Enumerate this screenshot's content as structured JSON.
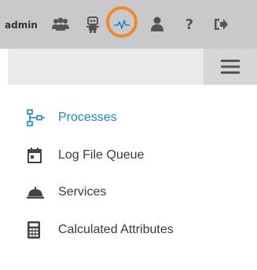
{
  "topbar": {
    "username": "admin",
    "icons": [
      "users-icon",
      "robot-icon",
      "activity-icon",
      "user-icon",
      "help-icon",
      "logout-icon"
    ],
    "help_glyph": "?",
    "highlight_color": "#f0892a",
    "active_icon_color": "#1e88c4"
  },
  "toolbar": {
    "menu_icon": "hamburger-menu-icon"
  },
  "menu": {
    "items": [
      {
        "label": "Processes",
        "icon": "process-flow-icon",
        "active": true
      },
      {
        "label": "Log File Queue",
        "icon": "calendar-icon",
        "active": false
      },
      {
        "label": "Services",
        "icon": "service-bell-icon",
        "active": false
      },
      {
        "label": "Calculated Attributes",
        "icon": "calculator-icon",
        "active": false
      }
    ]
  }
}
